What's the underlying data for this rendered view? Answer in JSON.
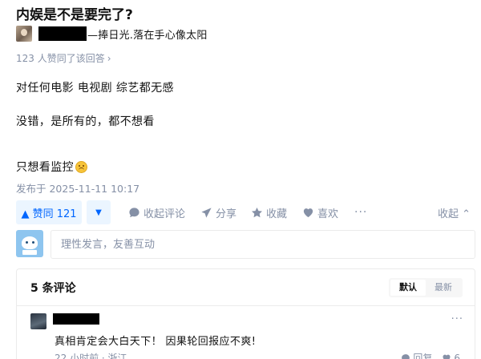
{
  "question": {
    "title": "内娱是不是要完了?"
  },
  "author": {
    "headline": "—捧日光.落在手心像太阳"
  },
  "vote_summary": {
    "text": "123 人赞同了该回答",
    "chevron": "›"
  },
  "content": {
    "paragraphs": [
      "对任何电影 电视剧 综艺都无感",
      "没错，是所有的，都不想看",
      "只想看监控"
    ],
    "emoji_icon": "upside-down-face-icon"
  },
  "publish_time": "发布于 2025-11-11 10:17",
  "actions": {
    "vote_up": "▲ 赞同 121",
    "vote_down": "▼",
    "comment": "收起评论",
    "share": "分享",
    "favorite": "收藏",
    "like": "喜欢",
    "more": "···",
    "collapse": "收起 ⌃"
  },
  "comment_editor": {
    "placeholder": "理性发言，友善互动"
  },
  "comments": {
    "count_label": "5 条评论",
    "sort_options": [
      "默认",
      "最新"
    ],
    "active_sort": "默认",
    "items": [
      {
        "text": "真相肯定会大白天下！ 因果轮回报应不爽!",
        "meta": "22 小时前 · 浙江",
        "reply_label": "回复",
        "like_count": "6"
      }
    ],
    "more": "···"
  },
  "colors": {
    "accent": "#0066ff",
    "accent_bg": "#ebf5ff",
    "muted": "#8590a6",
    "text": "#121212",
    "border": "#ebebeb"
  }
}
